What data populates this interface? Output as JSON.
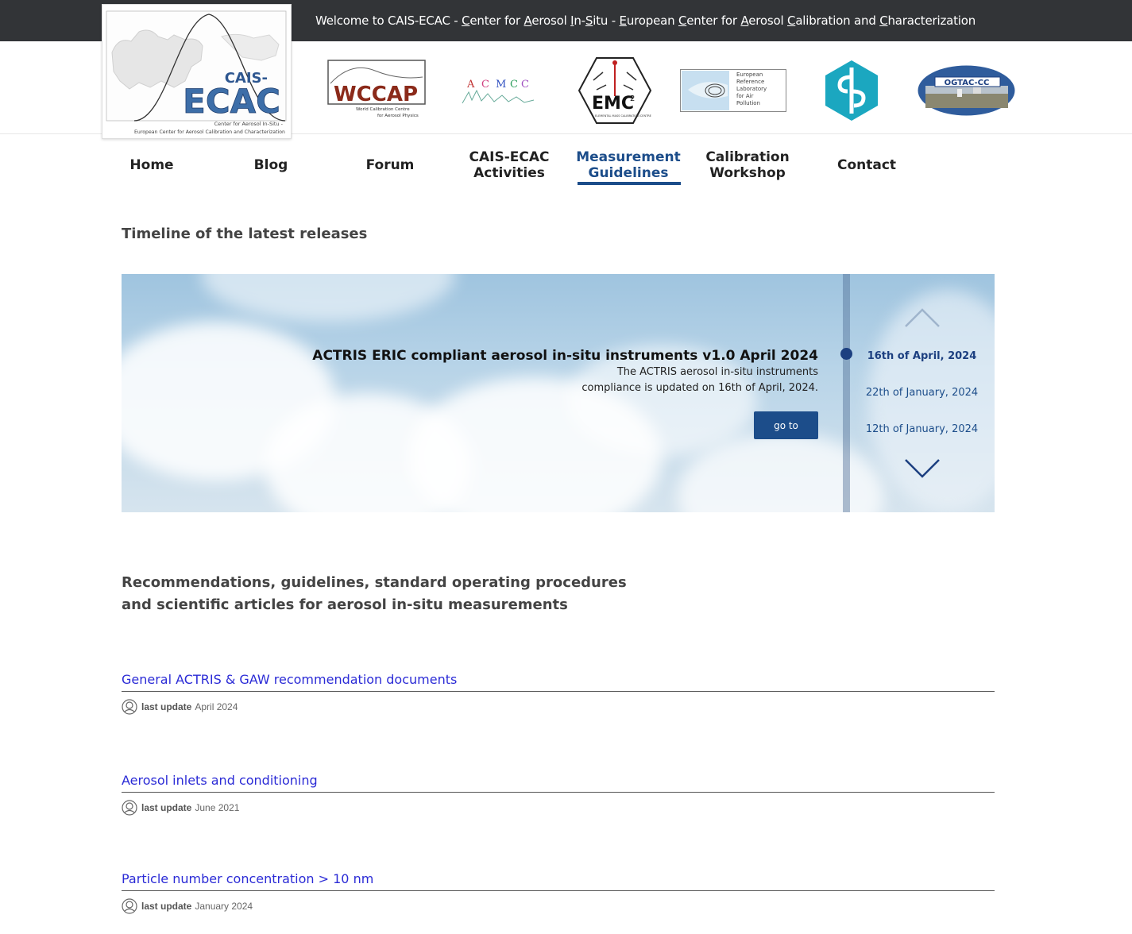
{
  "topbar": {
    "welcome_prefix": "Welcome to CAIS-ECAC - ",
    "welcome_parts": [
      {
        "u": "C",
        "t": "enter for "
      },
      {
        "u": "A",
        "t": "erosol "
      },
      {
        "u": "I",
        "t": "n-"
      },
      {
        "u": "S",
        "t": "itu - "
      },
      {
        "u": "E",
        "t": "uropean "
      },
      {
        "u": "C",
        "t": "enter for "
      },
      {
        "u": "A",
        "t": "erosol "
      },
      {
        "u": "C",
        "t": "alibration and "
      },
      {
        "u": "C",
        "t": "haracterization"
      }
    ]
  },
  "logo": {
    "name_top": "CAIS-",
    "name_main": "ECAC",
    "sub1": "Center for Aerosol In-Situ -",
    "sub2": "European Center for Aerosol Calibration and Characterization"
  },
  "partners": {
    "wccap": {
      "name": "WCCAP",
      "sub1": "World Calibration Centre",
      "sub2": "for Aerosol Physics"
    },
    "acmcc": {
      "letters": [
        "A",
        "C",
        "M",
        "C",
        "C"
      ]
    },
    "emc": {
      "name": "EMC",
      "sup": "2",
      "sub": "ELEMENTAL MASS CALIBRATION CENTRE"
    },
    "erlap": {
      "lines": [
        "European",
        "Reference",
        "Laboratory",
        "for Air",
        "Pollution"
      ]
    },
    "ogtac": {
      "name": "OGTAC-CC"
    }
  },
  "nav": {
    "items": [
      {
        "line1": "Home",
        "line2": ""
      },
      {
        "line1": "Blog",
        "line2": ""
      },
      {
        "line1": "Forum",
        "line2": ""
      },
      {
        "line1": "CAIS-ECAC",
        "line2": "Activities"
      },
      {
        "line1": "Measurement",
        "line2": "Guidelines"
      },
      {
        "line1": "Calibration",
        "line2": "Workshop"
      },
      {
        "line1": "Contact",
        "line2": ""
      }
    ],
    "active_index": 4
  },
  "timeline": {
    "heading": "Timeline of the latest releases",
    "release_title": "ACTRIS ERIC compliant aerosol in-situ instruments v1.0 April 2024",
    "release_desc_line1": "The ACTRIS aerosol in-situ instruments",
    "release_desc_line2": "compliance is updated on 16th of April, 2024.",
    "goto_label": "go to",
    "dates": [
      "16th of April, 2024",
      "22th of January, 2024",
      "12th of January, 2024"
    ],
    "active_date_index": 0
  },
  "recommendations": {
    "heading_line1": "Recommendations, guidelines, standard operating procedures",
    "heading_line2": "and scientific articles for aerosol in-situ measurements"
  },
  "documents": [
    {
      "title": "General ACTRIS & GAW recommendation documents",
      "meta_label": "last update",
      "meta_value": "April 2024"
    },
    {
      "title": "Aerosol inlets and conditioning",
      "meta_label": "last update",
      "meta_value": "June 2021"
    },
    {
      "title": "Particle number concentration > 10 nm",
      "meta_label": "last update",
      "meta_value": "January 2024"
    }
  ],
  "colors": {
    "topbar": "#323437",
    "accent": "#1c4d8a",
    "link": "#2b2bd6"
  }
}
